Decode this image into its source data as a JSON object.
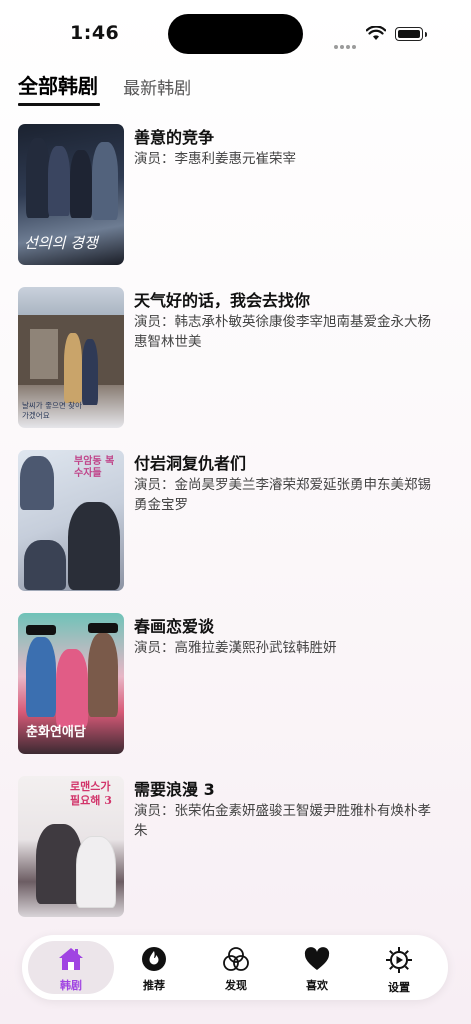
{
  "status_bar": {
    "time": "1:46"
  },
  "tabs": [
    {
      "label": "全部韩剧",
      "active": true
    },
    {
      "label": "最新韩剧",
      "active": false
    }
  ],
  "dramas": [
    {
      "title": "善意的竞争",
      "cast": "演员：李惠利姜惠元崔荣宰",
      "poster_text": "선의의 경쟁"
    },
    {
      "title": "天气好的话，我会去找你",
      "cast": "演员：韩志承朴敏英徐康俊李宰旭南基爱金永大杨惠智林世美",
      "poster_text": "날씨가 좋으면 찾아가겠어요"
    },
    {
      "title": "付岩洞复仇者们",
      "cast": "演员：金尚昊罗美兰李濬荣郑爱延张勇申东美郑锡勇金宝罗",
      "poster_text": "부암동 복수자들"
    },
    {
      "title": "春画恋爱谈",
      "cast": "演员：高雅拉姜漢熙孙武铉韩胜妍",
      "poster_text": "춘화연애담"
    },
    {
      "title": "需要浪漫 3",
      "cast": "演员：张荣佑金素妍盛骏王智媛尹胜雅朴有焕朴孝朱",
      "poster_text": "로맨스가 필요해 3"
    }
  ],
  "tabbar": {
    "items": [
      {
        "label": "韩剧",
        "icon": "home-icon",
        "active": true
      },
      {
        "label": "推荐",
        "icon": "flame-icon",
        "active": false
      },
      {
        "label": "发现",
        "icon": "discover-circles-icon",
        "active": false
      },
      {
        "label": "喜欢",
        "icon": "heart-icon",
        "active": false
      },
      {
        "label": "设置",
        "icon": "gear-icon",
        "active": false
      }
    ]
  },
  "colors": {
    "accent": "#a044e2",
    "active_tab_bg": "#ece5ea"
  }
}
